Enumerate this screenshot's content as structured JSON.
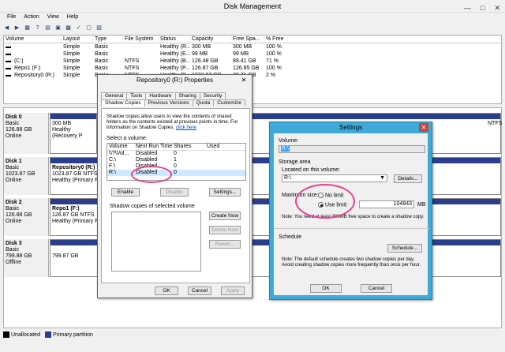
{
  "window": {
    "title": "Disk Management"
  },
  "menu": [
    "File",
    "Action",
    "View",
    "Help"
  ],
  "volumes": {
    "headers": [
      "Volume",
      "Layout",
      "Type",
      "File System",
      "Status",
      "Capacity",
      "Free Spa...",
      "% Free"
    ],
    "rows": [
      [
        "",
        "Simple",
        "Basic",
        "",
        "Healthy (R...",
        "300 MB",
        "300 MB",
        "100 %"
      ],
      [
        "",
        "Simple",
        "Basic",
        "",
        "Healthy (E...",
        "99 MB",
        "99 MB",
        "100 %"
      ],
      [
        "(C:)",
        "Simple",
        "Basic",
        "NTFS",
        "Healthy (B...",
        "126.48 GB",
        "89.41 GB",
        "71 %"
      ],
      [
        "Repo1 (F:)",
        "Simple",
        "Basic",
        "NTFS",
        "Healthy (P...",
        "126.87 GB",
        "126.85 GB",
        "100 %"
      ],
      [
        "Repository0 (R:)",
        "Simple",
        "Basic",
        "NTFS",
        "Healthy (P...",
        "1023.87 GB",
        "20.71 GB",
        "2 %"
      ]
    ]
  },
  "disks": [
    {
      "name": "Disk 0",
      "type": "Basic",
      "size": "126.88 GB",
      "status": "Online",
      "part1_size": "300 MB",
      "part1_status": "Healthy (Recovery P",
      "part2_text": "NTFS",
      "part2_status": "y (Boot, Page F"
    },
    {
      "name": "Disk 1",
      "type": "Basic",
      "size": "1023.87 GB",
      "status": "Online",
      "part_name": "Repository0 (R:)",
      "part_size": "1023.87 GB NTFS",
      "part_status": "Healthy (Primary Pa"
    },
    {
      "name": "Disk 2",
      "type": "Basic",
      "size": "126.88 GB",
      "status": "Online",
      "part_name": "Repo1 (F:)",
      "part_size": "126.87 GB NTFS",
      "part_status": "Healthy (Primary Pa"
    },
    {
      "name": "Disk 3",
      "type": "Basic",
      "size": "799.88 GB",
      "status": "Offline",
      "part_size": "799.87 GB"
    }
  ],
  "legend": {
    "unallocated": "Unallocated",
    "primary": "Primary partition",
    "unallocated_color": "#000000",
    "primary_color": "#2b3e8a"
  },
  "props": {
    "title": "Repository0 (R:) Properties",
    "tabs_row1": [
      "General",
      "Tools",
      "Hardware",
      "Sharing",
      "Security"
    ],
    "tabs_row2": [
      "Shadow Copies",
      "Previous Versions",
      "Quota",
      "Customize"
    ],
    "desc": "Shadow copies allow users to view the contents of shared folders as the contents existed at previous points in time. For information on Shadow Copies,",
    "link": "click here",
    "select_label": "Select a volume:",
    "cols": [
      "Volume",
      "Next Run Time",
      "Shares",
      "Used"
    ],
    "rows": [
      [
        "\\\\?\\Vol...",
        "Disabled",
        "0",
        ""
      ],
      [
        "C:\\",
        "Disabled",
        "1",
        ""
      ],
      [
        "F:\\",
        "Disabled",
        "0",
        ""
      ],
      [
        "R:\\",
        "Disabled",
        "0",
        ""
      ]
    ],
    "enable": "Enable",
    "disable": "Disable",
    "settings": "Settings...",
    "copies_label": "Shadow copies of selected volume",
    "create": "Create Now",
    "delete": "Delete Now",
    "revert": "Revert...",
    "ok": "OK",
    "cancel": "Cancel",
    "apply": "Apply"
  },
  "settings": {
    "title": "Settings",
    "volume_label": "Volume:",
    "volume_value": "R:\\",
    "storage_area": "Storage area",
    "located_label": "Located on this volume:",
    "located_value": "R:\\",
    "details": "Details...",
    "max_size": "Maximum size:",
    "no_limit": "No limit",
    "use_limit": "Use limit:",
    "limit_value": "104843",
    "unit": "MB",
    "note": "Note: You need at least 300MB free space to create a shadow copy.",
    "schedule": "Schedule",
    "schedule_btn": "Schedule...",
    "schedule_note": "Note: The default schedule creates two shadow copies per day. Avoid creating shadow copies more frequently than once per hour.",
    "ok": "OK",
    "cancel": "Cancel"
  },
  "colors": {
    "accent": "#3fa9d8",
    "annotation": "#e8418f"
  }
}
